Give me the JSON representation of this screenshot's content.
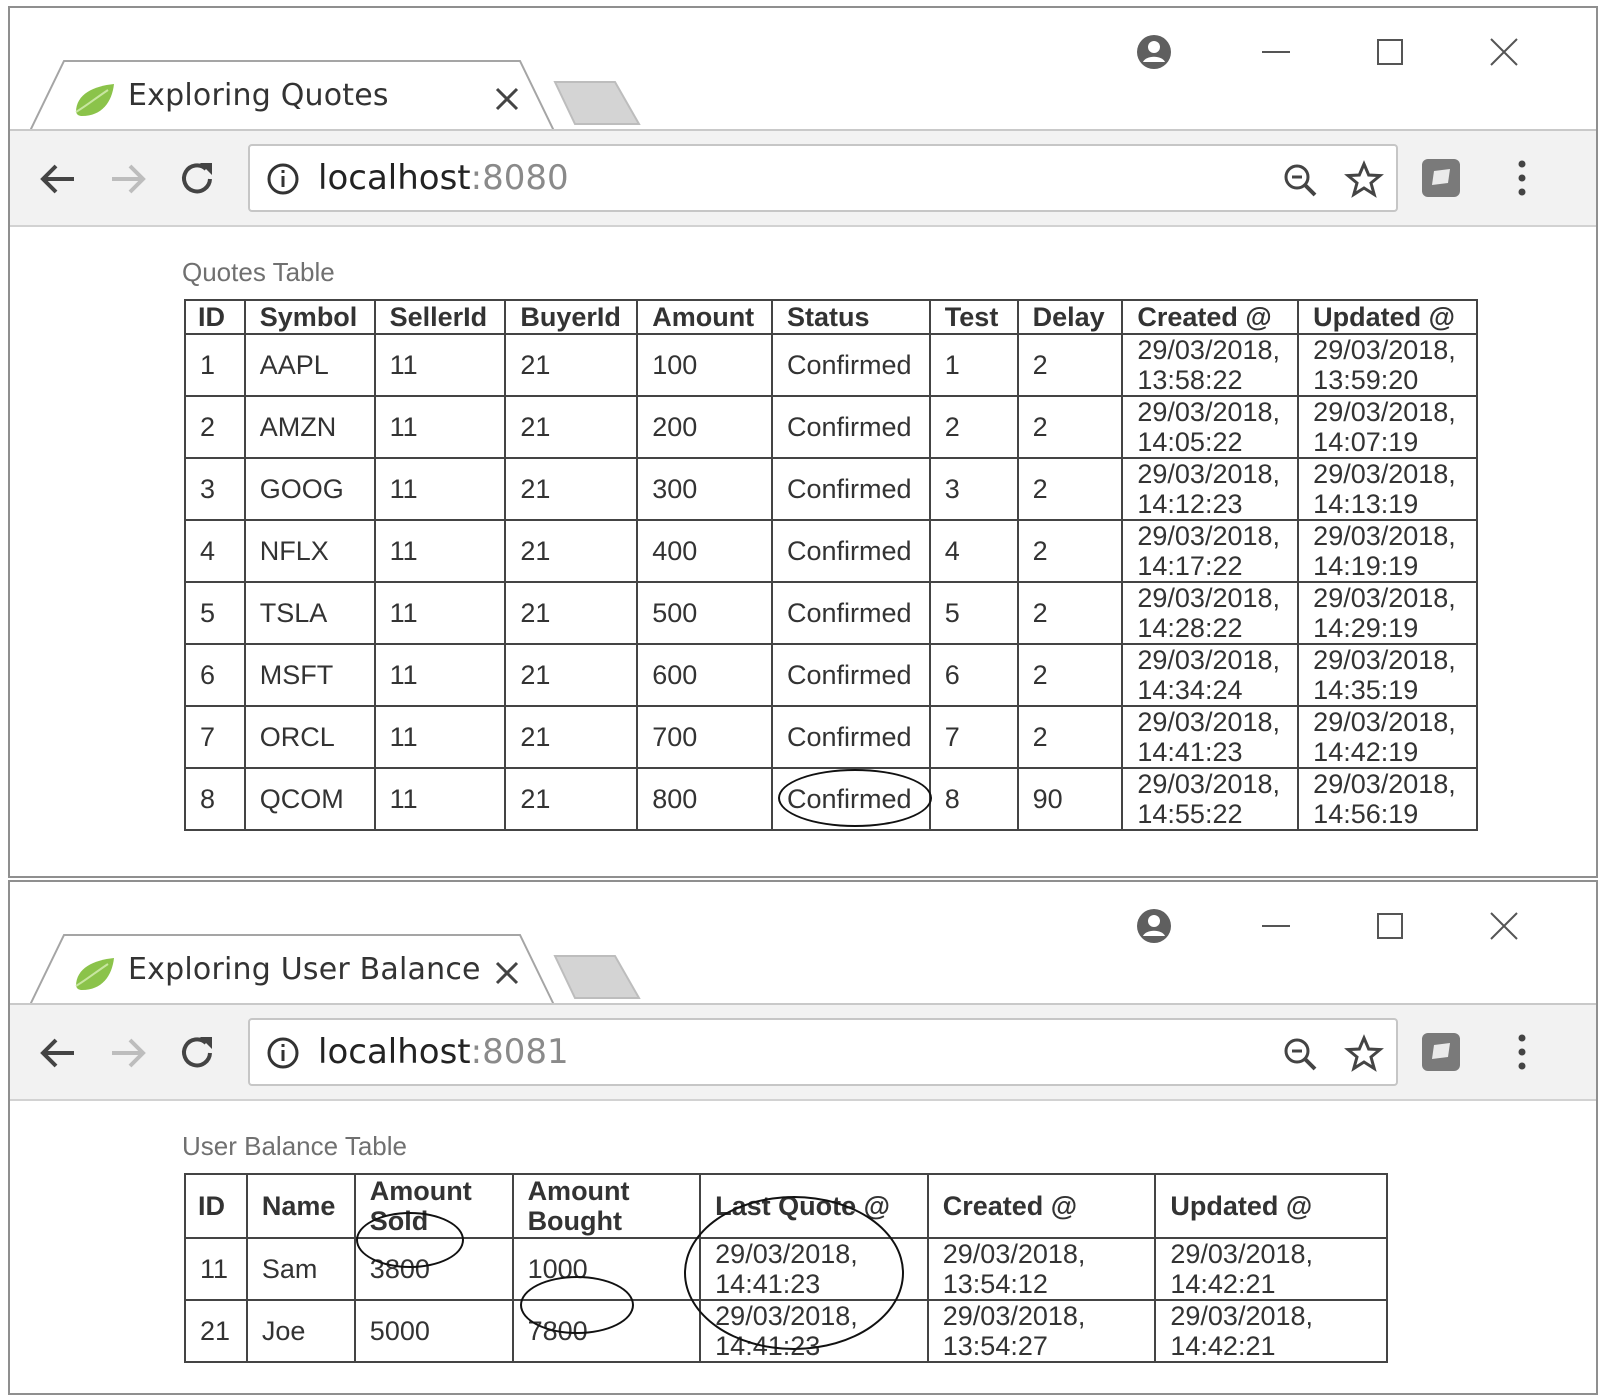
{
  "windows": [
    {
      "tab_title": "Exploring Quotes",
      "url_host": "localhost",
      "url_port": ":8080",
      "caption": "Quotes Table",
      "headers": [
        "ID",
        "Symbol",
        "SellerId",
        "BuyerId",
        "Amount",
        "Status",
        "Test",
        "Delay",
        "Created @",
        "Updated @"
      ],
      "rows": [
        {
          "id": "1",
          "symbol": "AAPL",
          "seller": "11",
          "buyer": "21",
          "amount": "100",
          "status": "Confirmed",
          "test": "1",
          "delay": "2",
          "created_d": "29/03/2018,",
          "created_t": "13:58:22",
          "updated_d": "29/03/2018,",
          "updated_t": "13:59:20"
        },
        {
          "id": "2",
          "symbol": "AMZN",
          "seller": "11",
          "buyer": "21",
          "amount": "200",
          "status": "Confirmed",
          "test": "2",
          "delay": "2",
          "created_d": "29/03/2018,",
          "created_t": "14:05:22",
          "updated_d": "29/03/2018,",
          "updated_t": "14:07:19"
        },
        {
          "id": "3",
          "symbol": "GOOG",
          "seller": "11",
          "buyer": "21",
          "amount": "300",
          "status": "Confirmed",
          "test": "3",
          "delay": "2",
          "created_d": "29/03/2018,",
          "created_t": "14:12:23",
          "updated_d": "29/03/2018,",
          "updated_t": "14:13:19"
        },
        {
          "id": "4",
          "symbol": "NFLX",
          "seller": "11",
          "buyer": "21",
          "amount": "400",
          "status": "Confirmed",
          "test": "4",
          "delay": "2",
          "created_d": "29/03/2018,",
          "created_t": "14:17:22",
          "updated_d": "29/03/2018,",
          "updated_t": "14:19:19"
        },
        {
          "id": "5",
          "symbol": "TSLA",
          "seller": "11",
          "buyer": "21",
          "amount": "500",
          "status": "Confirmed",
          "test": "5",
          "delay": "2",
          "created_d": "29/03/2018,",
          "created_t": "14:28:22",
          "updated_d": "29/03/2018,",
          "updated_t": "14:29:19"
        },
        {
          "id": "6",
          "symbol": "MSFT",
          "seller": "11",
          "buyer": "21",
          "amount": "600",
          "status": "Confirmed",
          "test": "6",
          "delay": "2",
          "created_d": "29/03/2018,",
          "created_t": "14:34:24",
          "updated_d": "29/03/2018,",
          "updated_t": "14:35:19"
        },
        {
          "id": "7",
          "symbol": "ORCL",
          "seller": "11",
          "buyer": "21",
          "amount": "700",
          "status": "Confirmed",
          "test": "7",
          "delay": "2",
          "created_d": "29/03/2018,",
          "created_t": "14:41:23",
          "updated_d": "29/03/2018,",
          "updated_t": "14:42:19"
        },
        {
          "id": "8",
          "symbol": "QCOM",
          "seller": "11",
          "buyer": "21",
          "amount": "800",
          "status": "Confirmed",
          "test": "8",
          "delay": "90",
          "created_d": "29/03/2018,",
          "created_t": "14:55:22",
          "updated_d": "29/03/2018,",
          "updated_t": "14:56:19"
        }
      ]
    },
    {
      "tab_title": "Exploring User Balance",
      "url_host": "localhost",
      "url_port": ":8081",
      "caption": "User Balance Table",
      "headers": [
        "ID",
        "Name",
        "Amount",
        "Sold",
        "Amount",
        "Bought",
        "Last Quote @",
        "Created @",
        "Updated @"
      ],
      "rows": [
        {
          "id": "11",
          "name": "Sam",
          "sold": "3800",
          "bought": "1000",
          "last_d": "29/03/2018,",
          "last_t": "14:41:23",
          "created_d": "29/03/2018,",
          "created_t": "13:54:12",
          "updated_d": "29/03/2018,",
          "updated_t": "14:42:21"
        },
        {
          "id": "21",
          "name": "Joe",
          "sold": "5000",
          "bought": "7800",
          "last_d": "29/03/2018,",
          "last_t": "14:41:23",
          "created_d": "29/03/2018,",
          "created_t": "13:54:27",
          "updated_d": "29/03/2018,",
          "updated_t": "14:42:21"
        }
      ]
    }
  ],
  "icons": {
    "profile": "profile-icon",
    "minimize": "minimize-icon",
    "maximize": "maximize-icon",
    "close": "close-icon",
    "back": "back-arrow-icon",
    "forward": "forward-arrow-icon",
    "reload": "reload-icon",
    "info": "info-icon",
    "zoom": "zoom-out-icon",
    "star": "bookmark-star-icon",
    "extension": "extension-icon",
    "menu": "kebab-menu-icon",
    "logo": "spring-leaf-logo"
  },
  "colors": {
    "toolbar_bg": "#f2f2f2",
    "leaf_green": "#8bc34a",
    "port_gray": "#8a8a8a"
  }
}
